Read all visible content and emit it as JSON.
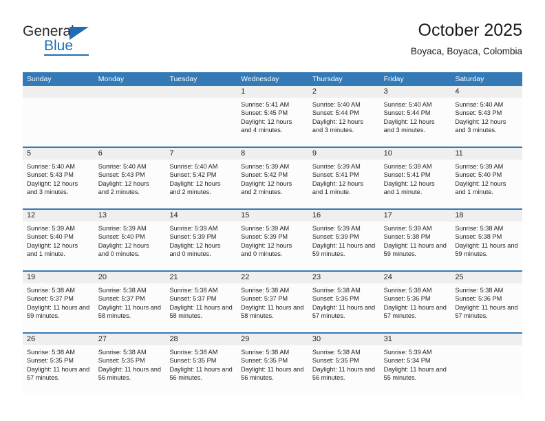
{
  "brand": {
    "name_top": "General",
    "name_bottom": "Blue",
    "accent_color": "#1f6db5"
  },
  "header": {
    "title": "October 2025",
    "subtitle": "Boyaca, Boyaca, Colombia"
  },
  "theme": {
    "header_band": "#337ab7",
    "daynum_band": "#efefef",
    "cell_bg": "#fcfcfd",
    "text": "#222222"
  },
  "weekday_headers": [
    "Sunday",
    "Monday",
    "Tuesday",
    "Wednesday",
    "Thursday",
    "Friday",
    "Saturday"
  ],
  "labels": {
    "sunrise": "Sunrise:",
    "sunset": "Sunset:",
    "daylight": "Daylight:"
  },
  "weeks": [
    [
      {
        "day": "",
        "empty": true
      },
      {
        "day": "",
        "empty": true
      },
      {
        "day": "",
        "empty": true
      },
      {
        "day": "1",
        "sunrise": "Sunrise: 5:41 AM",
        "sunset": "Sunset: 5:45 PM",
        "daylight": "Daylight: 12 hours and 4 minutes."
      },
      {
        "day": "2",
        "sunrise": "Sunrise: 5:40 AM",
        "sunset": "Sunset: 5:44 PM",
        "daylight": "Daylight: 12 hours and 3 minutes."
      },
      {
        "day": "3",
        "sunrise": "Sunrise: 5:40 AM",
        "sunset": "Sunset: 5:44 PM",
        "daylight": "Daylight: 12 hours and 3 minutes."
      },
      {
        "day": "4",
        "sunrise": "Sunrise: 5:40 AM",
        "sunset": "Sunset: 5:43 PM",
        "daylight": "Daylight: 12 hours and 3 minutes."
      }
    ],
    [
      {
        "day": "5",
        "sunrise": "Sunrise: 5:40 AM",
        "sunset": "Sunset: 5:43 PM",
        "daylight": "Daylight: 12 hours and 3 minutes."
      },
      {
        "day": "6",
        "sunrise": "Sunrise: 5:40 AM",
        "sunset": "Sunset: 5:43 PM",
        "daylight": "Daylight: 12 hours and 2 minutes."
      },
      {
        "day": "7",
        "sunrise": "Sunrise: 5:40 AM",
        "sunset": "Sunset: 5:42 PM",
        "daylight": "Daylight: 12 hours and 2 minutes."
      },
      {
        "day": "8",
        "sunrise": "Sunrise: 5:39 AM",
        "sunset": "Sunset: 5:42 PM",
        "daylight": "Daylight: 12 hours and 2 minutes."
      },
      {
        "day": "9",
        "sunrise": "Sunrise: 5:39 AM",
        "sunset": "Sunset: 5:41 PM",
        "daylight": "Daylight: 12 hours and 1 minute."
      },
      {
        "day": "10",
        "sunrise": "Sunrise: 5:39 AM",
        "sunset": "Sunset: 5:41 PM",
        "daylight": "Daylight: 12 hours and 1 minute."
      },
      {
        "day": "11",
        "sunrise": "Sunrise: 5:39 AM",
        "sunset": "Sunset: 5:40 PM",
        "daylight": "Daylight: 12 hours and 1 minute."
      }
    ],
    [
      {
        "day": "12",
        "sunrise": "Sunrise: 5:39 AM",
        "sunset": "Sunset: 5:40 PM",
        "daylight": "Daylight: 12 hours and 1 minute."
      },
      {
        "day": "13",
        "sunrise": "Sunrise: 5:39 AM",
        "sunset": "Sunset: 5:40 PM",
        "daylight": "Daylight: 12 hours and 0 minutes."
      },
      {
        "day": "14",
        "sunrise": "Sunrise: 5:39 AM",
        "sunset": "Sunset: 5:39 PM",
        "daylight": "Daylight: 12 hours and 0 minutes."
      },
      {
        "day": "15",
        "sunrise": "Sunrise: 5:39 AM",
        "sunset": "Sunset: 5:39 PM",
        "daylight": "Daylight: 12 hours and 0 minutes."
      },
      {
        "day": "16",
        "sunrise": "Sunrise: 5:39 AM",
        "sunset": "Sunset: 5:39 PM",
        "daylight": "Daylight: 11 hours and 59 minutes."
      },
      {
        "day": "17",
        "sunrise": "Sunrise: 5:39 AM",
        "sunset": "Sunset: 5:38 PM",
        "daylight": "Daylight: 11 hours and 59 minutes."
      },
      {
        "day": "18",
        "sunrise": "Sunrise: 5:38 AM",
        "sunset": "Sunset: 5:38 PM",
        "daylight": "Daylight: 11 hours and 59 minutes."
      }
    ],
    [
      {
        "day": "19",
        "sunrise": "Sunrise: 5:38 AM",
        "sunset": "Sunset: 5:37 PM",
        "daylight": "Daylight: 11 hours and 59 minutes."
      },
      {
        "day": "20",
        "sunrise": "Sunrise: 5:38 AM",
        "sunset": "Sunset: 5:37 PM",
        "daylight": "Daylight: 11 hours and 58 minutes."
      },
      {
        "day": "21",
        "sunrise": "Sunrise: 5:38 AM",
        "sunset": "Sunset: 5:37 PM",
        "daylight": "Daylight: 11 hours and 58 minutes."
      },
      {
        "day": "22",
        "sunrise": "Sunrise: 5:38 AM",
        "sunset": "Sunset: 5:37 PM",
        "daylight": "Daylight: 11 hours and 58 minutes."
      },
      {
        "day": "23",
        "sunrise": "Sunrise: 5:38 AM",
        "sunset": "Sunset: 5:36 PM",
        "daylight": "Daylight: 11 hours and 57 minutes."
      },
      {
        "day": "24",
        "sunrise": "Sunrise: 5:38 AM",
        "sunset": "Sunset: 5:36 PM",
        "daylight": "Daylight: 11 hours and 57 minutes."
      },
      {
        "day": "25",
        "sunrise": "Sunrise: 5:38 AM",
        "sunset": "Sunset: 5:36 PM",
        "daylight": "Daylight: 11 hours and 57 minutes."
      }
    ],
    [
      {
        "day": "26",
        "sunrise": "Sunrise: 5:38 AM",
        "sunset": "Sunset: 5:35 PM",
        "daylight": "Daylight: 11 hours and 57 minutes."
      },
      {
        "day": "27",
        "sunrise": "Sunrise: 5:38 AM",
        "sunset": "Sunset: 5:35 PM",
        "daylight": "Daylight: 11 hours and 56 minutes."
      },
      {
        "day": "28",
        "sunrise": "Sunrise: 5:38 AM",
        "sunset": "Sunset: 5:35 PM",
        "daylight": "Daylight: 11 hours and 56 minutes."
      },
      {
        "day": "29",
        "sunrise": "Sunrise: 5:38 AM",
        "sunset": "Sunset: 5:35 PM",
        "daylight": "Daylight: 11 hours and 56 minutes."
      },
      {
        "day": "30",
        "sunrise": "Sunrise: 5:38 AM",
        "sunset": "Sunset: 5:35 PM",
        "daylight": "Daylight: 11 hours and 56 minutes."
      },
      {
        "day": "31",
        "sunrise": "Sunrise: 5:39 AM",
        "sunset": "Sunset: 5:34 PM",
        "daylight": "Daylight: 11 hours and 55 minutes."
      },
      {
        "day": "",
        "empty": true
      }
    ]
  ]
}
